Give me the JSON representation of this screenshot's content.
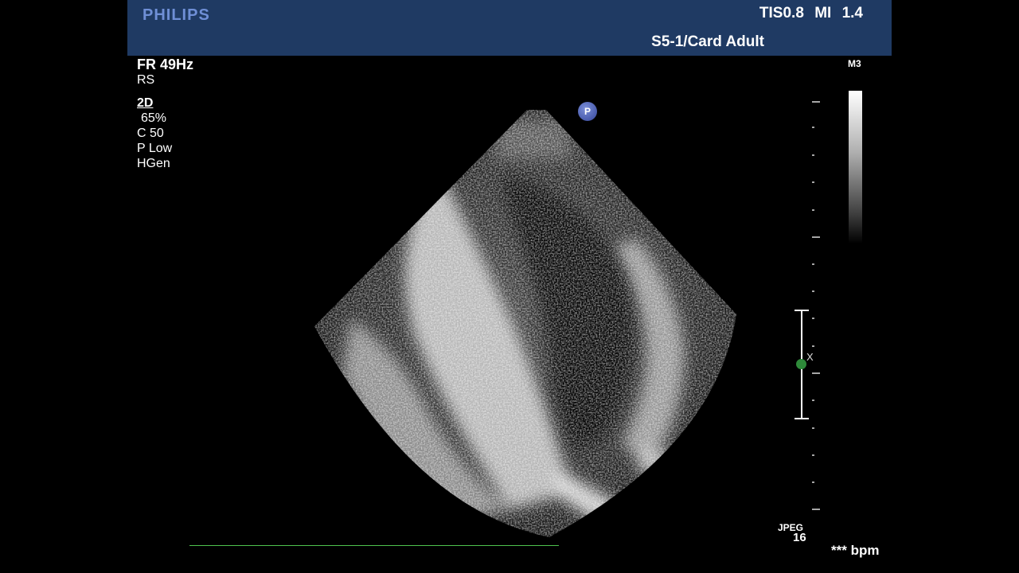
{
  "header": {
    "brand": "PHILIPS",
    "tis": "TIS0.8",
    "mi": "MI 1.4",
    "probe_preset": "S5-1/Card Adult"
  },
  "imaging_params": {
    "frame_rate": "FR 49Hz",
    "rs": "RS",
    "mode": "2D",
    "gain": "65%",
    "compression": "C 50",
    "power": "P Low",
    "frequency": "HGen"
  },
  "map_label": "M3",
  "orientation_marker": "P",
  "focus_marker": "X",
  "jpeg_label": "JPEG",
  "jpeg_quality": "16",
  "heart_rate": "*** bpm",
  "colors": {
    "header_bg": "#1f3a63",
    "brand": "#6f8fd6",
    "ecg_trace": "#4ec24e",
    "focus_dot": "#2e8a3a"
  }
}
